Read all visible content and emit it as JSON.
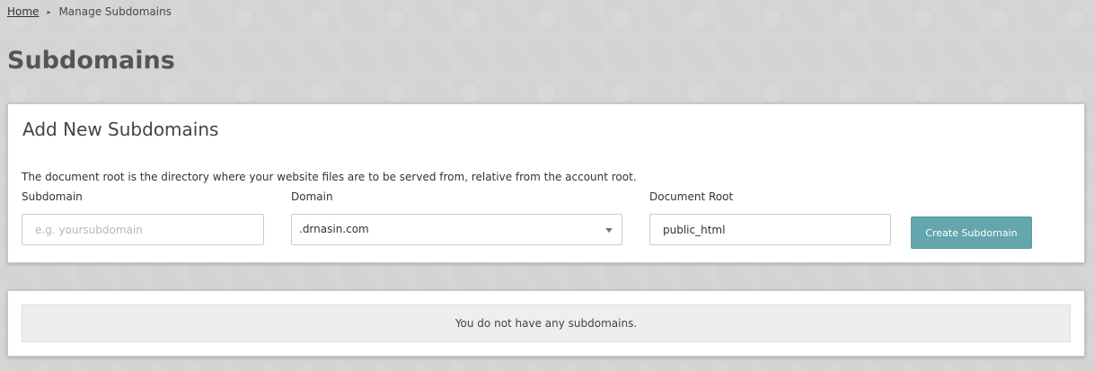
{
  "breadcrumb": {
    "home": "Home",
    "separator": "▸",
    "current": "Manage Subdomains"
  },
  "page": {
    "title": "Subdomains"
  },
  "add_panel": {
    "title": "Add New Subdomains",
    "description": "The document root is the directory where your website files are to be served from, relative from the account root.",
    "subdomain": {
      "label": "Subdomain",
      "placeholder": "e.g. yoursubdomain",
      "value": ""
    },
    "domain": {
      "label": "Domain",
      "selected": ".drnasin.com"
    },
    "document_root": {
      "label": "Document Root",
      "value": "public_html"
    },
    "create_button": "Create Subdomain"
  },
  "list_panel": {
    "empty_message": "You do not have any subdomains."
  },
  "colors": {
    "background": "#d4d4d4",
    "panel": "#ffffff",
    "accent_button": "#63a6ad",
    "empty_box": "#eeeeee",
    "title_text": "#555555"
  },
  "icons": {
    "breadcrumb_separator": "triangle-right-icon",
    "domain_dropdown": "caret-down-icon"
  }
}
